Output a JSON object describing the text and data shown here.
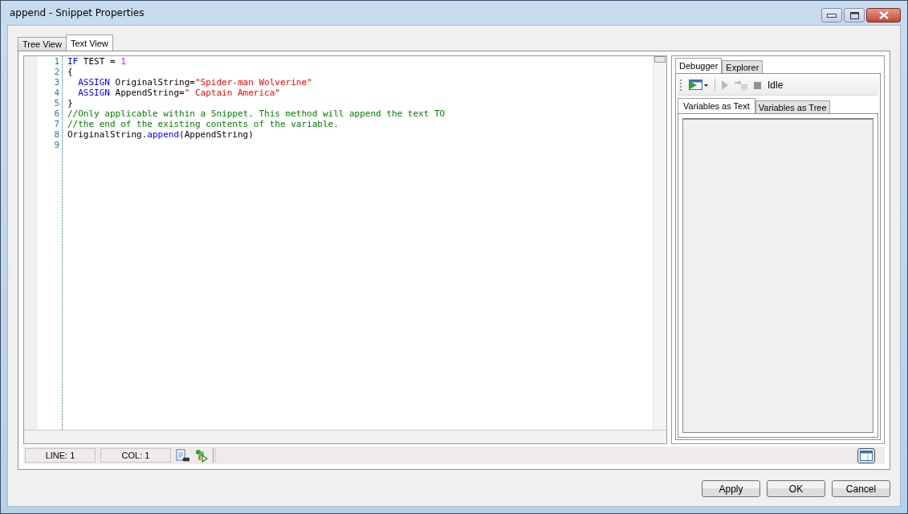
{
  "window": {
    "title": "append - Snippet Properties"
  },
  "tabs": [
    {
      "label": "Tree View",
      "selected": false
    },
    {
      "label": "Text View",
      "selected": true
    }
  ],
  "code_lines": [
    {
      "number": "1",
      "tokens": [
        {
          "kind": "keyword",
          "text": "IF"
        },
        {
          "kind": "plain",
          "text": " TEST = "
        },
        {
          "kind": "number",
          "text": "1"
        }
      ]
    },
    {
      "number": "2",
      "tokens": [
        {
          "kind": "plain",
          "text": "{"
        }
      ]
    },
    {
      "number": "3",
      "indented": true,
      "tokens": [
        {
          "kind": "keyword",
          "text": "ASSIGN"
        },
        {
          "kind": "plain",
          "text": " OriginalString="
        },
        {
          "kind": "string",
          "text": "\"Spider-man Wolverine\""
        }
      ]
    },
    {
      "number": "4",
      "indented": true,
      "tokens": [
        {
          "kind": "keyword",
          "text": "ASSIGN"
        },
        {
          "kind": "plain",
          "text": " AppendString="
        },
        {
          "kind": "string",
          "text": "\" Captain America\""
        }
      ]
    },
    {
      "number": "5",
      "tokens": [
        {
          "kind": "plain",
          "text": "}"
        }
      ]
    },
    {
      "number": "6",
      "tokens": [
        {
          "kind": "comment",
          "text": "//Only applicable within a Snippet. This method will append the text TO"
        }
      ]
    },
    {
      "number": "7",
      "tokens": [
        {
          "kind": "comment",
          "text": "//the end of the existing contents of the variable."
        }
      ]
    },
    {
      "number": "8",
      "tokens": [
        {
          "kind": "plain",
          "text": "OriginalString."
        },
        {
          "kind": "method",
          "text": "append"
        },
        {
          "kind": "plain",
          "text": "(AppendString)"
        }
      ]
    },
    {
      "number": "9"
    }
  ],
  "side_tabs": [
    {
      "label": "Debugger",
      "selected": true
    },
    {
      "label": "Explorer",
      "selected": false
    }
  ],
  "debugger": {
    "status": "Idle"
  },
  "variable_tabs": [
    {
      "label": "Variables as Text",
      "selected": true
    },
    {
      "label": "Variables as Tree",
      "selected": false
    }
  ],
  "status_bar": {
    "line": "LINE: 1",
    "col": "COL: 1"
  },
  "buttons": [
    "Apply",
    "OK",
    "Cancel"
  ]
}
